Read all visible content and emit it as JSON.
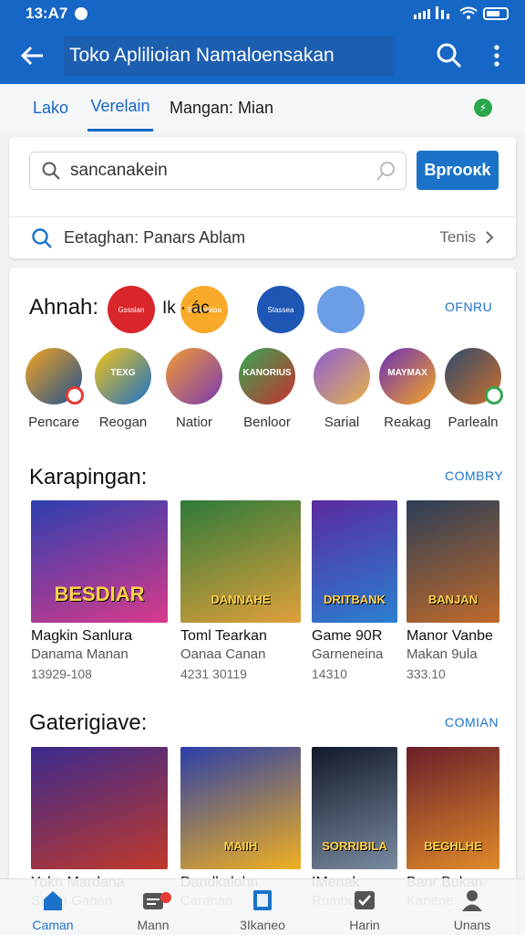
{
  "status": {
    "time": "13:A7"
  },
  "appbar": {
    "title": "Toko Aplilioian Namaloensakan"
  },
  "tabs": [
    {
      "label": "Lako"
    },
    {
      "label": "Verelain"
    },
    {
      "label": "Mangan: Mian"
    }
  ],
  "search": {
    "value": "sancanakein",
    "button_label": "Bprοoκk"
  },
  "suggestion": {
    "label": "Eetaghan: Panars Ablam",
    "more_label": "Tenis"
  },
  "section_top": {
    "title": "Ahnah:",
    "title_suffix": "Ik · ác",
    "link": "OFNRU",
    "chips": [
      {
        "color": "#d9262b",
        "text": "Gssslan"
      },
      {
        "color": "#f7a927",
        "text": "Srssceaba"
      },
      {
        "color": "#1d56b4",
        "text": "Stassea"
      },
      {
        "color": "#6b9ee6",
        "text": ""
      }
    ],
    "apps": [
      {
        "label": "Pencаre",
        "icon": "sunset-app-icon",
        "c1": "#f5a623",
        "c2": "#1d4f91"
      },
      {
        "label": "Reogan",
        "icon": "texg-app-icon",
        "c1": "#f5c518",
        "c2": "#1b70c9",
        "text": "TEXG"
      },
      {
        "label": "Natior",
        "icon": "cross-app-icon",
        "c1": "#f29b32",
        "c2": "#7a3bb3"
      },
      {
        "label": "Benloor",
        "icon": "kanorius-app-icon",
        "c1": "#34a853",
        "c2": "#c83030",
        "text": "KANORIUS"
      },
      {
        "label": "Sarial",
        "icon": "warrior-app-icon",
        "c1": "#8e5cd6",
        "c2": "#e6b54a"
      },
      {
        "label": "Reakag",
        "icon": "maymax-app-icon",
        "c1": "#6a2fb8",
        "c2": "#f6a623",
        "text": "MAYMAX"
      },
      {
        "label": "Parlealn",
        "icon": "knight-app-icon",
        "c1": "#2a4a6e",
        "c2": "#d0702a"
      }
    ]
  },
  "section_games": {
    "title": "Karapingan:",
    "link": "COMBRY",
    "items": [
      {
        "title": "Magkin Sanlura",
        "sub": "Danama Manan",
        "num": "13929-108",
        "banner": "BESDIAR",
        "c1": "#2d3fb0",
        "c2": "#d83a8a"
      },
      {
        "title": "Toml Tearkan",
        "sub": "Oanaa Canan",
        "num": "4231 30119",
        "banner": "DANNAHE",
        "c1": "#2f7a3a",
        "c2": "#e0a03a"
      },
      {
        "title": "Game 90R",
        "sub": "Garneneina",
        "num": "14310",
        "banner": "DRITBANK",
        "c1": "#5a2aa0",
        "c2": "#2a80d0"
      },
      {
        "title": "Manor Vanbe",
        "sub": "Makan 9ula",
        "num": "333.10",
        "banner": "BANJAN",
        "c1": "#2c3e57",
        "c2": "#c06a2a"
      }
    ]
  },
  "section_cat": {
    "title": "Gaterigiave:",
    "link": "COMIAN",
    "items": [
      {
        "title": "Yokn Mardana",
        "sub": "Serea Gaoan",
        "num": "",
        "banner": "",
        "c1": "#3b2a8e",
        "c2": "#c0392b"
      },
      {
        "title": "Dandkalohn",
        "sub": "Caranan",
        "num": "",
        "banner": "MAIIH",
        "c1": "#2b3fa8",
        "c2": "#f0b020"
      },
      {
        "title": "IMenak",
        "sub": "Rumbuan",
        "num": "",
        "banner": "SORRIBILA",
        "c1": "#121a2a",
        "c2": "#7a8aa0"
      },
      {
        "title": "Banr Bukan",
        "sub": "Kanene",
        "num": "",
        "banner": "BEGHLHE",
        "c1": "#6a1f2a",
        "c2": "#e08a2a"
      }
    ]
  },
  "bottomnav": [
    {
      "label": "Caman",
      "icon": "home-icon"
    },
    {
      "label": "Mann",
      "icon": "inbox-icon"
    },
    {
      "label": "3Ikaneo",
      "icon": "book-icon"
    },
    {
      "label": "Harin",
      "icon": "checkbox-icon"
    },
    {
      "label": "Unans",
      "icon": "person-icon"
    }
  ]
}
